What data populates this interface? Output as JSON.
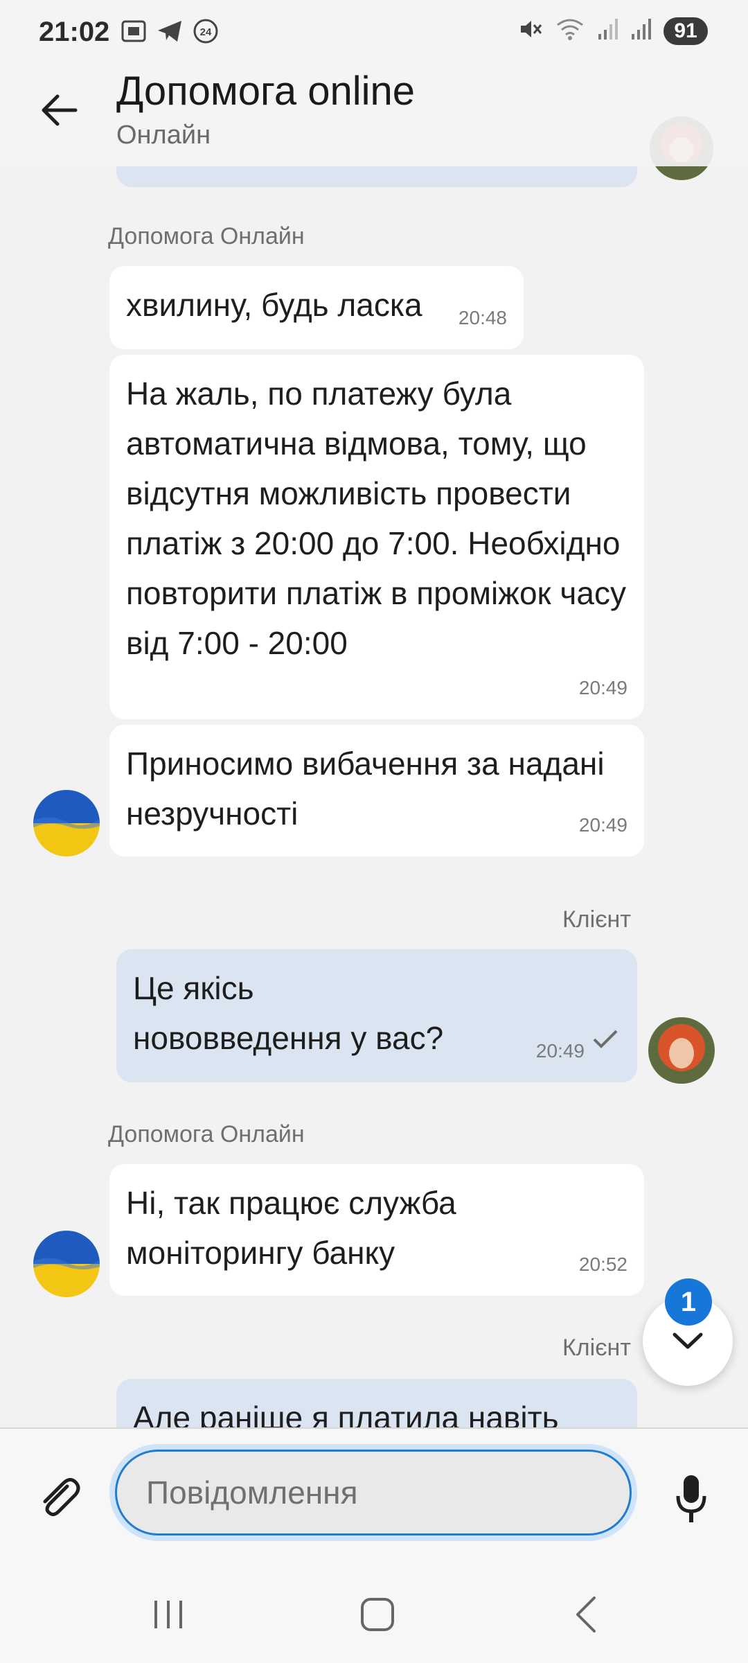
{
  "status_bar": {
    "time": "21:02",
    "left_icons": [
      "screenshot-icon",
      "telegram-icon",
      "24-badge-icon"
    ],
    "right_icons": [
      "mute-icon",
      "wifi-icon",
      "signal-icon",
      "signal-icon"
    ],
    "battery": "91"
  },
  "header": {
    "title": "Допомога online",
    "subtitle": "Онлайн"
  },
  "messages": [
    {
      "sender": "Допомога Онлайн",
      "direction": "in",
      "text": "хвилину, будь ласка",
      "time": "20:48"
    },
    {
      "direction": "in",
      "text": "На жаль, по платежу була автоматична відмова, тому, що відсутня можливість провести платіж з 20:00 до 7:00. Необхідно повторити платіж в проміжок часу від 7:00 - 20:00",
      "time": "20:49"
    },
    {
      "direction": "in",
      "text": "Приносимо вибачення за надані незручності",
      "time": "20:49"
    },
    {
      "sender": "Клієнт",
      "direction": "out",
      "text": "Це якісь нововведення у вас?",
      "time": "20:49",
      "status": "sent"
    },
    {
      "sender": "Допомога Онлайн",
      "direction": "in",
      "text": "Ні, так працює служба моніторингу банку",
      "time": "20:52"
    },
    {
      "sender": "Клієнт",
      "direction": "out",
      "text": "Але раніше я платила навіть"
    }
  ],
  "scroll_down": {
    "unread_count": "1"
  },
  "composer": {
    "placeholder": "Повідомлення",
    "attach_icon": "paperclip-icon",
    "mic_icon": "microphone-icon"
  },
  "navbar": {
    "icons": [
      "recent-apps-icon",
      "home-icon",
      "back-nav-icon"
    ]
  },
  "colors": {
    "accent": "#1677d8",
    "outgoing_bubble": "#dae5f1",
    "incoming_bubble": "#ffffff",
    "background": "#f2f2f2"
  }
}
